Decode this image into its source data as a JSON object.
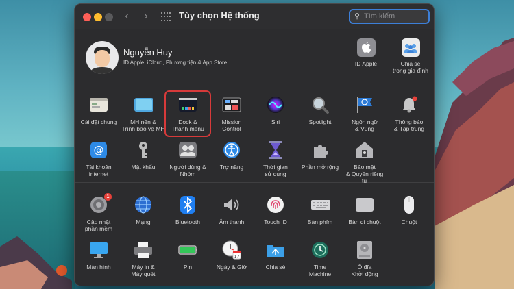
{
  "window": {
    "title": "Tùy chọn Hệ thống",
    "search_placeholder": "Tìm kiếm"
  },
  "account": {
    "name": "Nguyễn Huy",
    "subtitle": "ID Apple, iCloud, Phương tiện & App Store",
    "items": [
      {
        "label": "ID Apple",
        "icon": "apple-logo-icon"
      },
      {
        "label": "Chia sẻ\ntrong gia đình",
        "icon": "family-sharing-icon"
      }
    ]
  },
  "sections": {
    "row1": [
      {
        "label": "Cài đặt chung",
        "icon": "general-icon"
      },
      {
        "label": "MH nền &\nTrình bảo vệ MH",
        "icon": "desktop-screensaver-icon"
      },
      {
        "label": "Dock &\nThanh menu",
        "icon": "dock-menubar-icon",
        "selected": true
      },
      {
        "label": "Mission\nControl",
        "icon": "mission-control-icon"
      },
      {
        "label": "Siri",
        "icon": "siri-icon"
      },
      {
        "label": "Spotlight",
        "icon": "spotlight-icon"
      },
      {
        "label": "Ngôn ngữ\n& Vùng",
        "icon": "language-region-icon"
      },
      {
        "label": "Thông báo\n& Tập trung",
        "icon": "notifications-icon"
      }
    ],
    "row2": [
      {
        "label": "Tài khoản\ninternet",
        "icon": "internet-accounts-icon"
      },
      {
        "label": "Mật khẩu",
        "icon": "passwords-icon"
      },
      {
        "label": "Người dùng &\nNhóm",
        "icon": "users-groups-icon"
      },
      {
        "label": "Trợ năng",
        "icon": "accessibility-icon"
      },
      {
        "label": "Thời gian\nsử dụng",
        "icon": "screen-time-icon"
      },
      {
        "label": "Phần mở rộng",
        "icon": "extensions-icon"
      },
      {
        "label": "Bảo mật\n& Quyền riêng tư",
        "icon": "security-privacy-icon"
      }
    ],
    "row3": [
      {
        "label": "Cập nhật\nphần mềm",
        "icon": "software-update-icon",
        "badge": "1"
      },
      {
        "label": "Mạng",
        "icon": "network-icon"
      },
      {
        "label": "Bluetooth",
        "icon": "bluetooth-icon"
      },
      {
        "label": "Âm thanh",
        "icon": "sound-icon"
      },
      {
        "label": "Touch ID",
        "icon": "touch-id-icon"
      },
      {
        "label": "Bàn phím",
        "icon": "keyboard-icon"
      },
      {
        "label": "Bàn di chuột",
        "icon": "trackpad-icon"
      },
      {
        "label": "Chuột",
        "icon": "mouse-icon"
      }
    ],
    "row4": [
      {
        "label": "Màn hình",
        "icon": "displays-icon"
      },
      {
        "label": "Máy in &\nMáy quét",
        "icon": "printers-scanners-icon"
      },
      {
        "label": "Pin",
        "icon": "battery-icon"
      },
      {
        "label": "Ngày & Giờ",
        "icon": "date-time-icon"
      },
      {
        "label": "Chia sẻ",
        "icon": "sharing-icon"
      },
      {
        "label": "Time\nMachine",
        "icon": "time-machine-icon"
      },
      {
        "label": "Ổ đĩa\nKhởi động",
        "icon": "startup-disk-icon"
      }
    ]
  },
  "colors": {
    "window_bg": "#2c2c2e",
    "selection_outline": "#d73a3a",
    "search_focus": "#3d7fd8"
  }
}
